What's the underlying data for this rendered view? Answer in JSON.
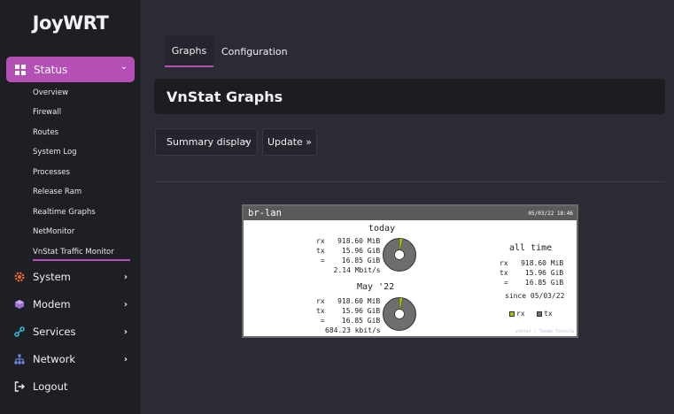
{
  "brand": "JoyWRT",
  "sidebar": {
    "status": "Status",
    "sub_items": [
      "Overview",
      "Firewall",
      "Routes",
      "System Log",
      "Processes",
      "Release Ram",
      "Realtime Graphs",
      "NetMonitor",
      "VnStat Traffic Monitor"
    ],
    "menus": [
      "System",
      "Modem",
      "Services",
      "Network",
      "Logout"
    ]
  },
  "tabs": {
    "graphs": "Graphs",
    "configuration": "Configuration"
  },
  "page_title": "VnStat Graphs",
  "controls": {
    "select_value": "Summary display",
    "update_label": "Update »"
  },
  "vnstat": {
    "interface": "br-lan",
    "generated": "05/03/22 18:46",
    "today_title": "today",
    "today_rx": "rx   918.60 MiB",
    "today_tx": "tx    15.96 GiB",
    "today_total": " =    16.85 GiB",
    "today_rate": "  2.14 Mbit/s",
    "month_title": "May '22",
    "month_rx": "rx   918.60 MiB",
    "month_tx": "tx    15.96 GiB",
    "month_total": " =    16.85 GiB",
    "month_rate": "684.23 kbit/s",
    "alltime_title": "all time",
    "alltime_rx": "rx   918.60 MiB",
    "alltime_tx": "tx    15.96 GiB",
    "alltime_total": " =    16.85 GiB",
    "since": "since 05/03/22",
    "legend_rx": "rx",
    "legend_tx": "tx",
    "footer": "vnStat / Teemu Toivola",
    "rx_color": "#a0c800",
    "tx_color": "#6e6e6e"
  },
  "colors": {
    "accent": "#b34fb5"
  }
}
